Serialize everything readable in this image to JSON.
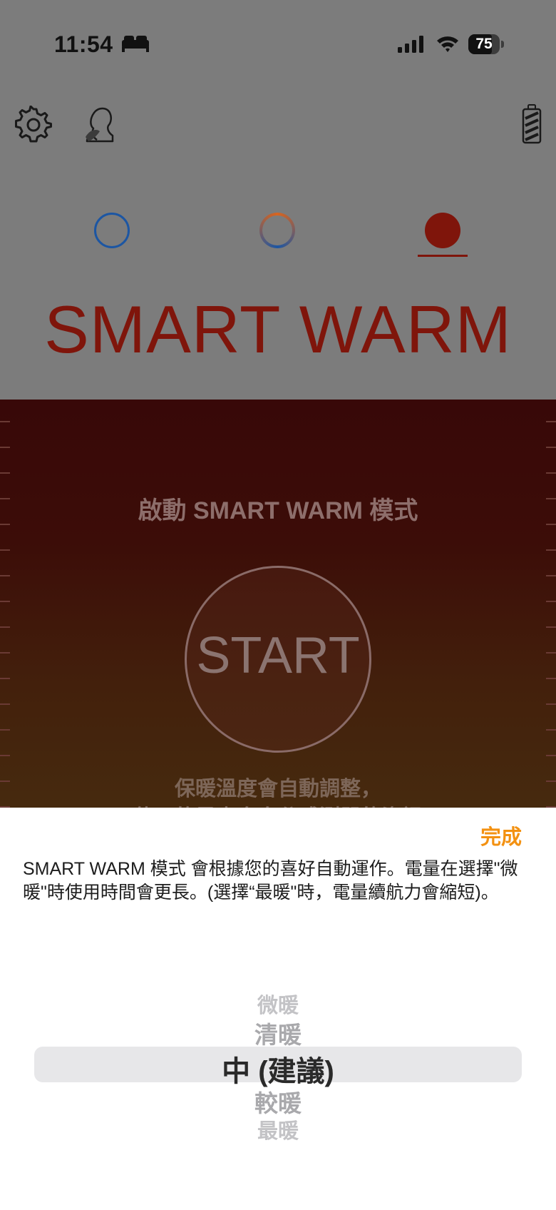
{
  "status_bar": {
    "time": "11:54",
    "battery_percent": "75"
  },
  "header": {
    "icons": [
      "gear-icon",
      "profile-icon",
      "device-battery-icon"
    ]
  },
  "modes": {
    "selected": "warm",
    "title": "SMART WARM",
    "colors": {
      "cool": "#1c56a3",
      "warm": "#7f150b",
      "accent": "#f39111"
    }
  },
  "panel": {
    "heading": "啟動 SMART WARM 模式",
    "start_label": "START",
    "hint_line1": "保暖溫度會自動調整，",
    "hint_line2": "使用的是專身身分感測器的資訊"
  },
  "sheet": {
    "done_label": "完成",
    "description": "SMART WARM 模式 會根據您的喜好自動運作。電量在選擇\"微暖\"時使用時間會更長。(選擇“最暖\"時，電量續航力會縮短)。",
    "options": [
      "微暖",
      "清暖",
      "中 (建議)",
      "較暖",
      "最暖"
    ],
    "selected_index": 2
  }
}
